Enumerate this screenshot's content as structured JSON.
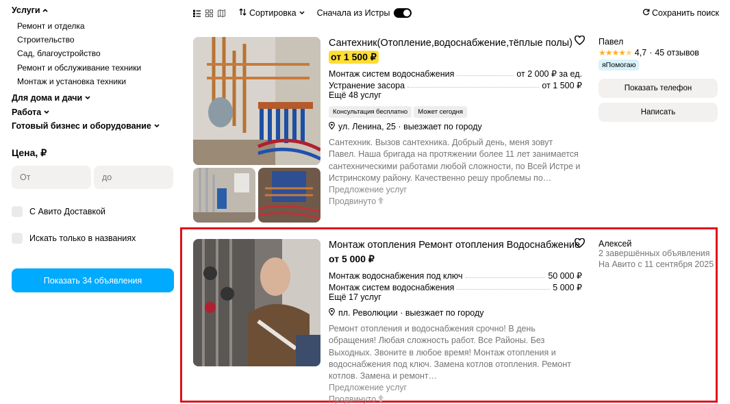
{
  "sidebar": {
    "services_label": "Услуги",
    "subcategories": [
      "Ремонт и отделка",
      "Строительство",
      "Сад, благоустройство",
      "Ремонт и обслуживание техники",
      "Монтаж и установка техники"
    ],
    "categories": [
      "Для дома и дачи",
      "Работа",
      "Готовый бизнес и оборудование"
    ],
    "price_title": "Цена, ₽",
    "price_from_placeholder": "От",
    "price_to_placeholder": "до",
    "avito_delivery_label": "С Авито Доставкой",
    "titles_only_label": "Искать только в названиях",
    "show_button": "Показать 34 объявления"
  },
  "toolbar": {
    "sort_label": "Сортировка",
    "first_from_label": "Сначала из Истры",
    "first_from_enabled": true,
    "save_search_label": "Сохранить поиск"
  },
  "listings": [
    {
      "title": "Сантехник(Отопление,водоснабжение,тёплые полы)",
      "price": "от 1 500 ₽",
      "price_highlight": true,
      "services": [
        {
          "name": "Монтаж систем водоснабжения",
          "price": "от 2 000 ₽ за ед."
        },
        {
          "name": "Устранение засора",
          "price": "от 1 500 ₽"
        }
      ],
      "more_services": "Ещё 48 услуг",
      "badges": [
        "Консультация бесплатно",
        "Может сегодня"
      ],
      "address": "ул. Ленина, 25 · выезжает по городу",
      "description": "Сантехник. Вызов сантехника. Добрый день, меня зовут Павел. Наша бригада на протяжении более 11 лет занимается сантехническими работами любой сложности, по Всей Истре и Истринскому району. Качественно решу проблемы по…",
      "offer_label": "Предложение услуг",
      "promoted_label": "Продвинуто",
      "seller": {
        "name": "Павел",
        "rating": "4,7",
        "rating_stars": 4.7,
        "reviews": "45 отзывов",
        "badge": "яПомогаю",
        "phone_button": "Показать телефон",
        "write_button": "Написать"
      }
    },
    {
      "title": "Монтаж отопления Ремонт отопления Водоснабжение",
      "price": "от 5 000 ₽",
      "price_highlight": false,
      "services": [
        {
          "name": "Монтаж водоснабжения под ключ",
          "price": "50 000 ₽"
        },
        {
          "name": "Монтаж систем водоснабжения",
          "price": "5 000 ₽"
        }
      ],
      "more_services": "Ещё 17 услуг",
      "address": "пл. Революции · выезжает по городу",
      "description": "Ремонт отопления и водоснабжения срочно! В день обращения! Любая сложность работ. Все Районы. Без Выходных. Звоните в любое время! Монтаж отопления и водоснабжения под ключ. Замена котлов отопления. Ремонт котлов. Замена и ремонт…",
      "offer_label": "Предложение услуг",
      "promoted_label": "Продвинуто",
      "seller": {
        "name": "Алексей",
        "completed": "2 завершённых объявления",
        "since": "На Авито с 11 сентября 2025"
      }
    }
  ],
  "colors": {
    "accent": "#00aaff",
    "highlight_frame": "#e0101b",
    "price_highlight": "#ffdd33",
    "star": "#ffb021"
  }
}
